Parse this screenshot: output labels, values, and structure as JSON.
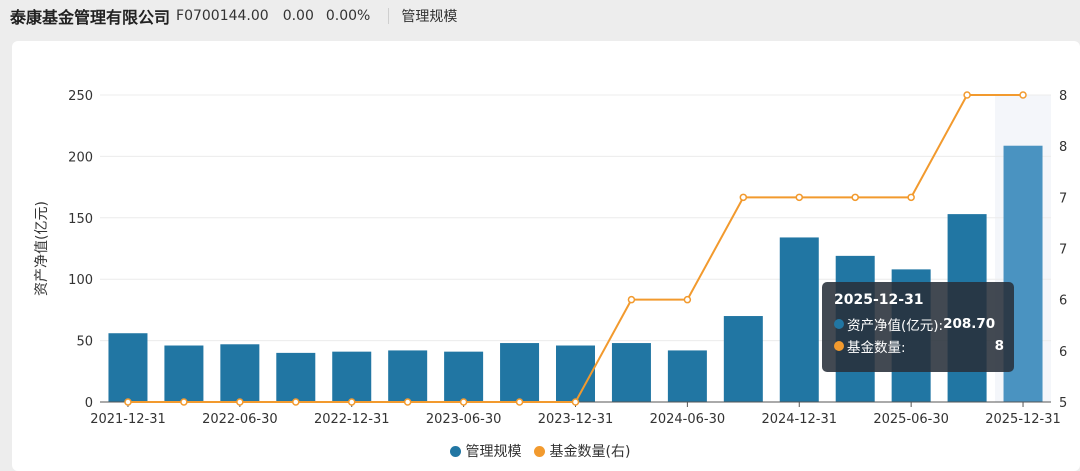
{
  "header": {
    "company": "泰康基金管理有限公司",
    "code": "F0700144.00",
    "value": "0.00",
    "change": "0.00%",
    "tab": "管理规模"
  },
  "colors": {
    "bar": "#2176a3",
    "bar_highlight": "#4a93c1",
    "line": "#f29a2e",
    "highlight_band": "#f4f6fa"
  },
  "chart_data": {
    "type": "bar",
    "categories": [
      "2021-12-31",
      "2022-03-31",
      "2022-06-30",
      "2022-09-30",
      "2022-12-31",
      "2023-03-31",
      "2023-06-30",
      "2023-09-30",
      "2023-12-31",
      "2024-03-31",
      "2024-06-30",
      "2024-09-30",
      "2024-12-31",
      "2025-03-31",
      "2025-06-30",
      "2025-09-30",
      "2025-12-31"
    ],
    "x_tick_labels": [
      "2021-12-31",
      "2022-06-30",
      "2022-12-31",
      "2023-06-30",
      "2023-12-31",
      "2024-06-30",
      "2024-12-31",
      "2025-06-30",
      "2025-12-31"
    ],
    "series": [
      {
        "name": "管理规模",
        "type": "bar",
        "axis": "left",
        "values": [
          56,
          46,
          47,
          40,
          41,
          42,
          41,
          48,
          46,
          48,
          42,
          70,
          134,
          119,
          108,
          153,
          208.7
        ]
      },
      {
        "name": "基金数量(右)",
        "type": "line",
        "axis": "right",
        "values": [
          5,
          5,
          5,
          5,
          5,
          5,
          5,
          5,
          5,
          6,
          6,
          7,
          7,
          7,
          7,
          8,
          8
        ]
      }
    ],
    "ylabel": "资产净值(亿元)",
    "ylim": [
      0,
      250
    ],
    "y_ticks": [
      0,
      50,
      100,
      150,
      200,
      250
    ],
    "y2lim": [
      5,
      8
    ],
    "y2_tick_labels": [
      "5",
      "6",
      "6",
      "7",
      "7",
      "8",
      "8"
    ],
    "grid": true,
    "legend_position": "bottom",
    "highlight_index": 16
  },
  "legend": [
    {
      "label": "管理规模",
      "color": "#2176a3"
    },
    {
      "label": "基金数量(右)",
      "color": "#f29a2e"
    }
  ],
  "tooltip": {
    "title": "2025-12-31",
    "rows": [
      {
        "label": "资产净值(亿元):",
        "value": "208.70",
        "color": "#2176a3"
      },
      {
        "label": "基金数量:",
        "value": "8",
        "color": "#f29a2e"
      }
    ]
  }
}
